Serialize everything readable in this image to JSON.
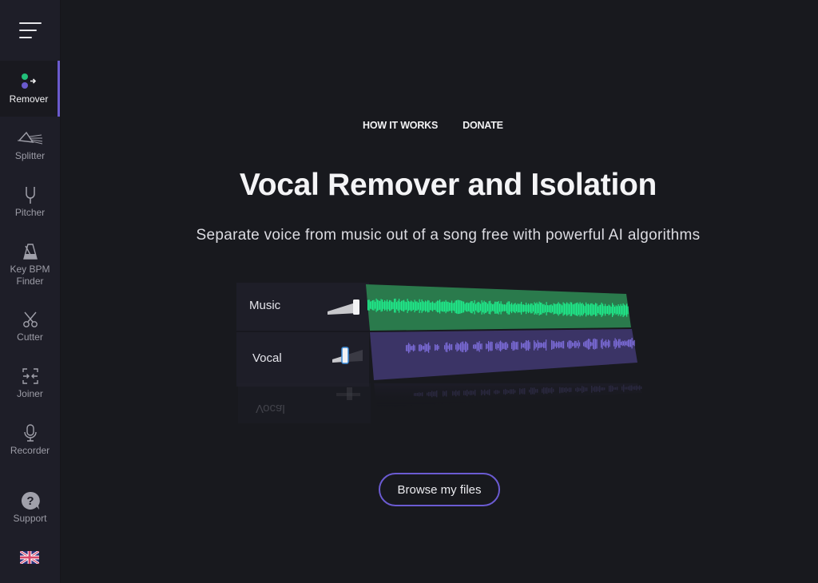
{
  "sidebar": {
    "menu_icon": "hamburger-menu-icon",
    "items": [
      {
        "label": "Remover",
        "icon": "remover-icon",
        "active": true
      },
      {
        "label": "Splitter",
        "icon": "prism-icon"
      },
      {
        "label": "Pitcher",
        "icon": "tuning-fork-icon"
      },
      {
        "label": "Key BPM",
        "label2": "Finder",
        "icon": "metronome-icon"
      },
      {
        "label": "Cutter",
        "icon": "scissors-icon"
      },
      {
        "label": "Joiner",
        "icon": "joiner-icon"
      },
      {
        "label": "Recorder",
        "icon": "microphone-icon"
      },
      {
        "label": "Support",
        "icon": "help-icon"
      }
    ],
    "language_icon": "uk-flag-icon"
  },
  "topnav": {
    "how_it_works": "HOW IT WORKS",
    "donate": "DONATE"
  },
  "hero": {
    "title": "Vocal Remover and Isolation",
    "subtitle": "Separate voice from music out of a song free with powerful AI algorithms"
  },
  "illustration": {
    "tracks": [
      {
        "label": "Music",
        "volume": 1.0,
        "color": "#2a7a4c",
        "wave_color": "#1fe98a"
      },
      {
        "label": "Vocal",
        "volume": 0.35,
        "color": "#3b3466",
        "wave_color": "#7a6ad6"
      }
    ],
    "reflection_label": "Vocal"
  },
  "cta": {
    "browse_label": "Browse my files",
    "accent": "#6b5bd2"
  }
}
